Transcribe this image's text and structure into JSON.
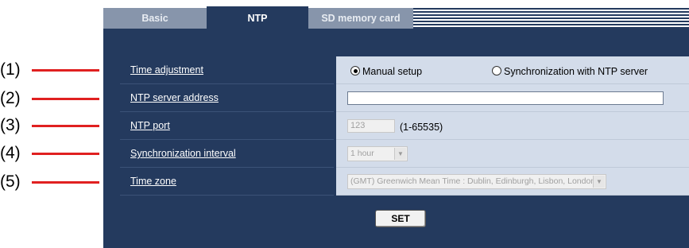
{
  "callouts": [
    "(1)",
    "(2)",
    "(3)",
    "(4)",
    "(5)"
  ],
  "tabs": [
    {
      "label": "Basic",
      "active": false
    },
    {
      "label": "NTP",
      "active": true
    },
    {
      "label": "SD memory card",
      "active": false
    }
  ],
  "rows": {
    "time_adjustment": {
      "label": "Time adjustment",
      "options": [
        "Manual setup",
        "Synchronization with NTP server"
      ],
      "selected": "Manual setup"
    },
    "ntp_server_address": {
      "label": "NTP server address",
      "value": ""
    },
    "ntp_port": {
      "label": "NTP port",
      "value": "123",
      "range_hint": "(1-65535)"
    },
    "sync_interval": {
      "label": "Synchronization interval",
      "selected": "1 hour"
    },
    "time_zone": {
      "label": "Time zone",
      "selected": "(GMT) Greenwich Mean Time : Dublin, Edinburgh, Lisbon, London"
    }
  },
  "set_button": "SET",
  "colors": {
    "panel": "#243a5e",
    "value_cell": "#d3dcea",
    "callout_line": "#e02020",
    "inactive_tab": "#8795ab"
  }
}
